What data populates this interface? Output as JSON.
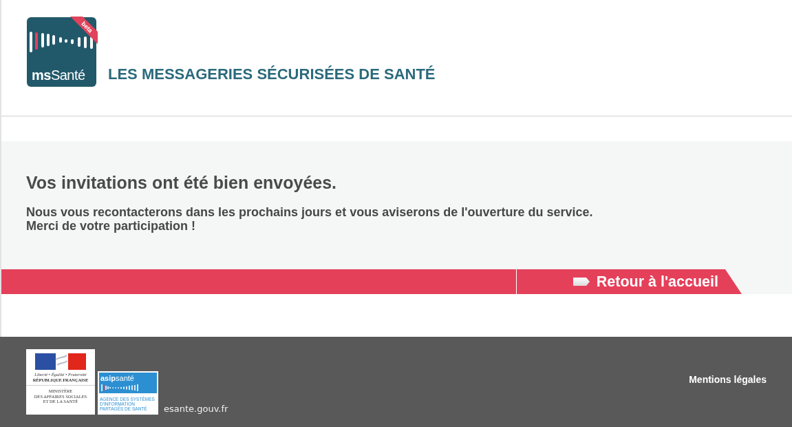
{
  "header": {
    "logo": {
      "badge": "beta",
      "wordmark": "**ms**Santé"
    },
    "tagline": "LES MESSAGERIES SÉCURISÉES DE SANTÉ"
  },
  "confirmation": {
    "title": "Vos invitations ont été bien envoyées.",
    "message": [
      "Nous vous recontacterons dans les prochains jours et vous aviserons de l'ouverture du service.",
      "Merci de votre participation !"
    ],
    "home_button": "Retour à l'accueil"
  },
  "footer": {
    "republic_logo": {
      "motto": "Liberté • Égalité • Fraternité",
      "name": "RÉPUBLIQUE FRANÇAISE",
      "ministry": [
        "MINISTÈRE",
        "DES AFFAIRES SOCIALES",
        "ET DE LA SANTÉ"
      ]
    },
    "agency_logo": {
      "wordmark": "**asip**santé",
      "name": [
        "AGENCE DES SYSTÈMES",
        "D'INFORMATION",
        "PARTAGÉS DE SANTÉ"
      ]
    },
    "site": "esante.gouv.fr",
    "legal_link": "Mentions légales"
  }
}
